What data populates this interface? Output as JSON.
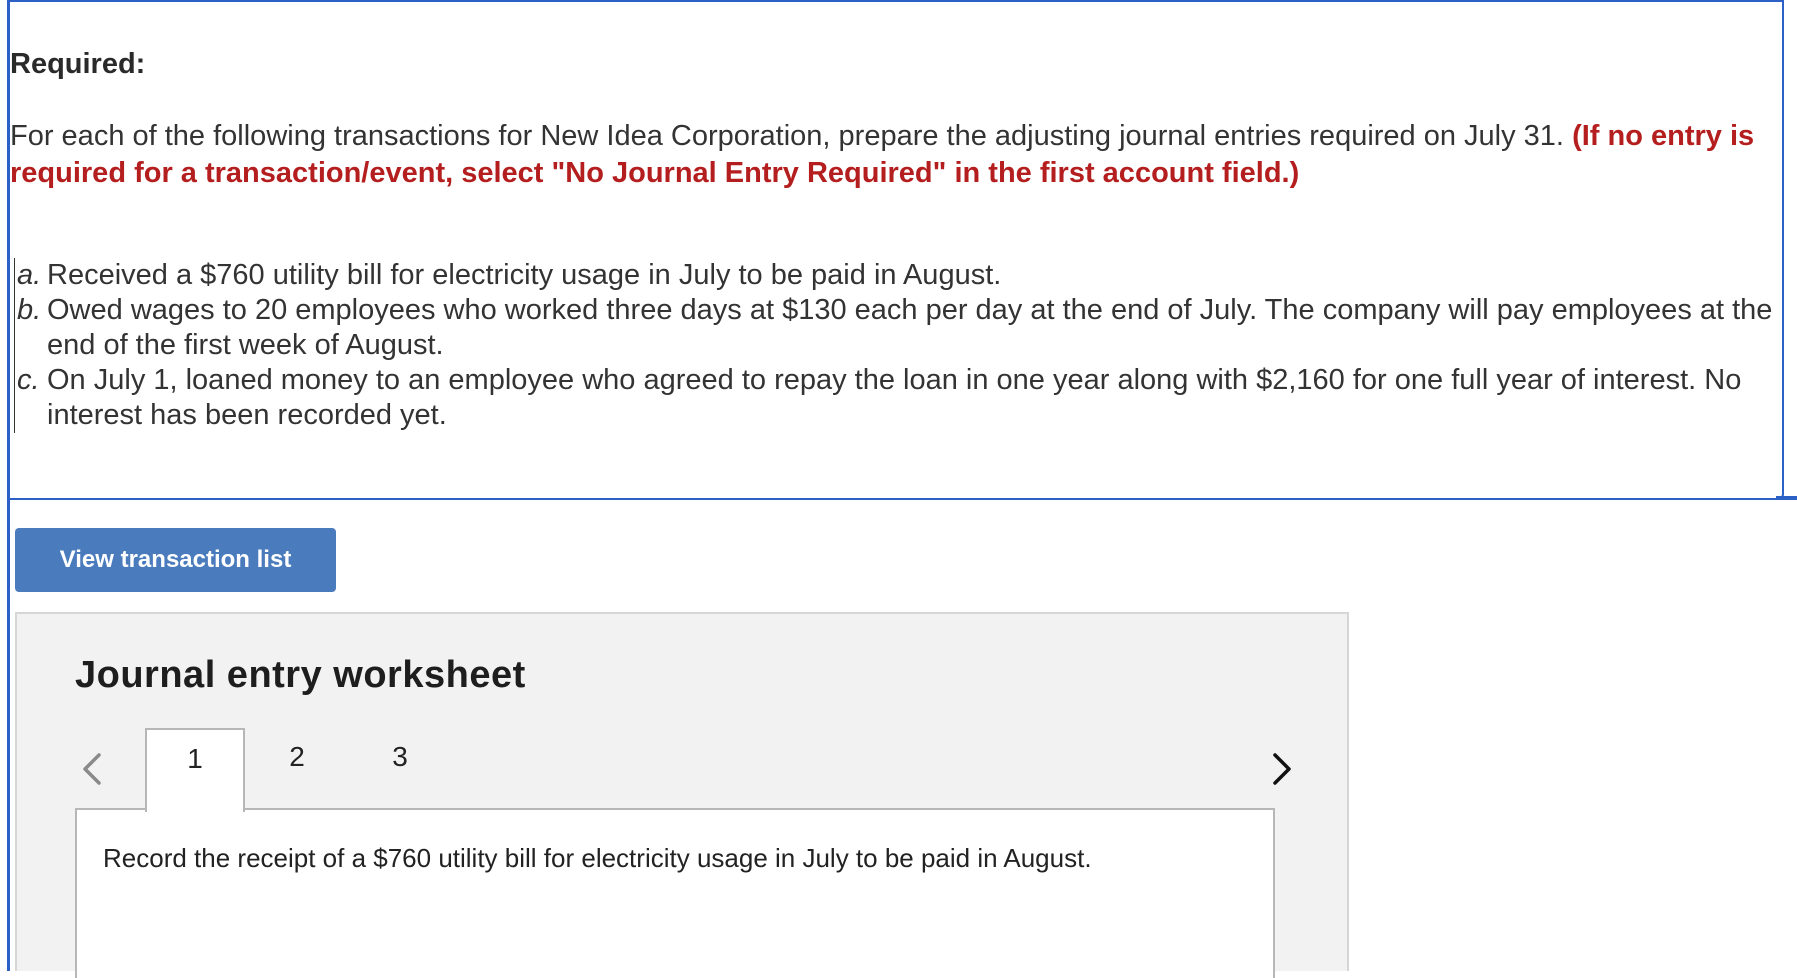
{
  "heading": "Required:",
  "instructions": {
    "text": "For each of  the following transactions for New Idea Corporation, prepare the adjusting journal entries required on July 31. ",
    "note": "(If no entry is required for a transaction/event, select \"No Journal Entry Required\" in the first account field.)"
  },
  "transactions": [
    {
      "letter": "a.",
      "text": "Received a $760 utility bill for electricity usage in July to be paid in August."
    },
    {
      "letter": "b.",
      "text": "Owed wages to 20 employees who worked three days at $130 each per day at the end of July. The company will pay employees at the end of the first week of August."
    },
    {
      "letter": "c.",
      "text": "On July 1, loaned money to an employee who agreed to repay the loan in one year along with $2,160 for one full year of interest. No interest has been recorded yet."
    }
  ],
  "view_button": {
    "label": "View transaction list"
  },
  "worksheet": {
    "title": "Journal entry worksheet",
    "tabs": [
      {
        "label": "1",
        "active": true
      },
      {
        "label": "2",
        "active": false
      },
      {
        "label": "3",
        "active": false
      }
    ],
    "prompt": "Record the receipt of a $760 utility bill for electricity usage in July to be paid in August."
  },
  "colors": {
    "frame_border": "#2b60c7",
    "note_red": "#b41e1e",
    "button_blue": "#4a7bbd",
    "worksheet_bg": "#f2f2f2"
  },
  "icons": {
    "prev": "chevron-left-icon",
    "next": "chevron-right-icon"
  }
}
